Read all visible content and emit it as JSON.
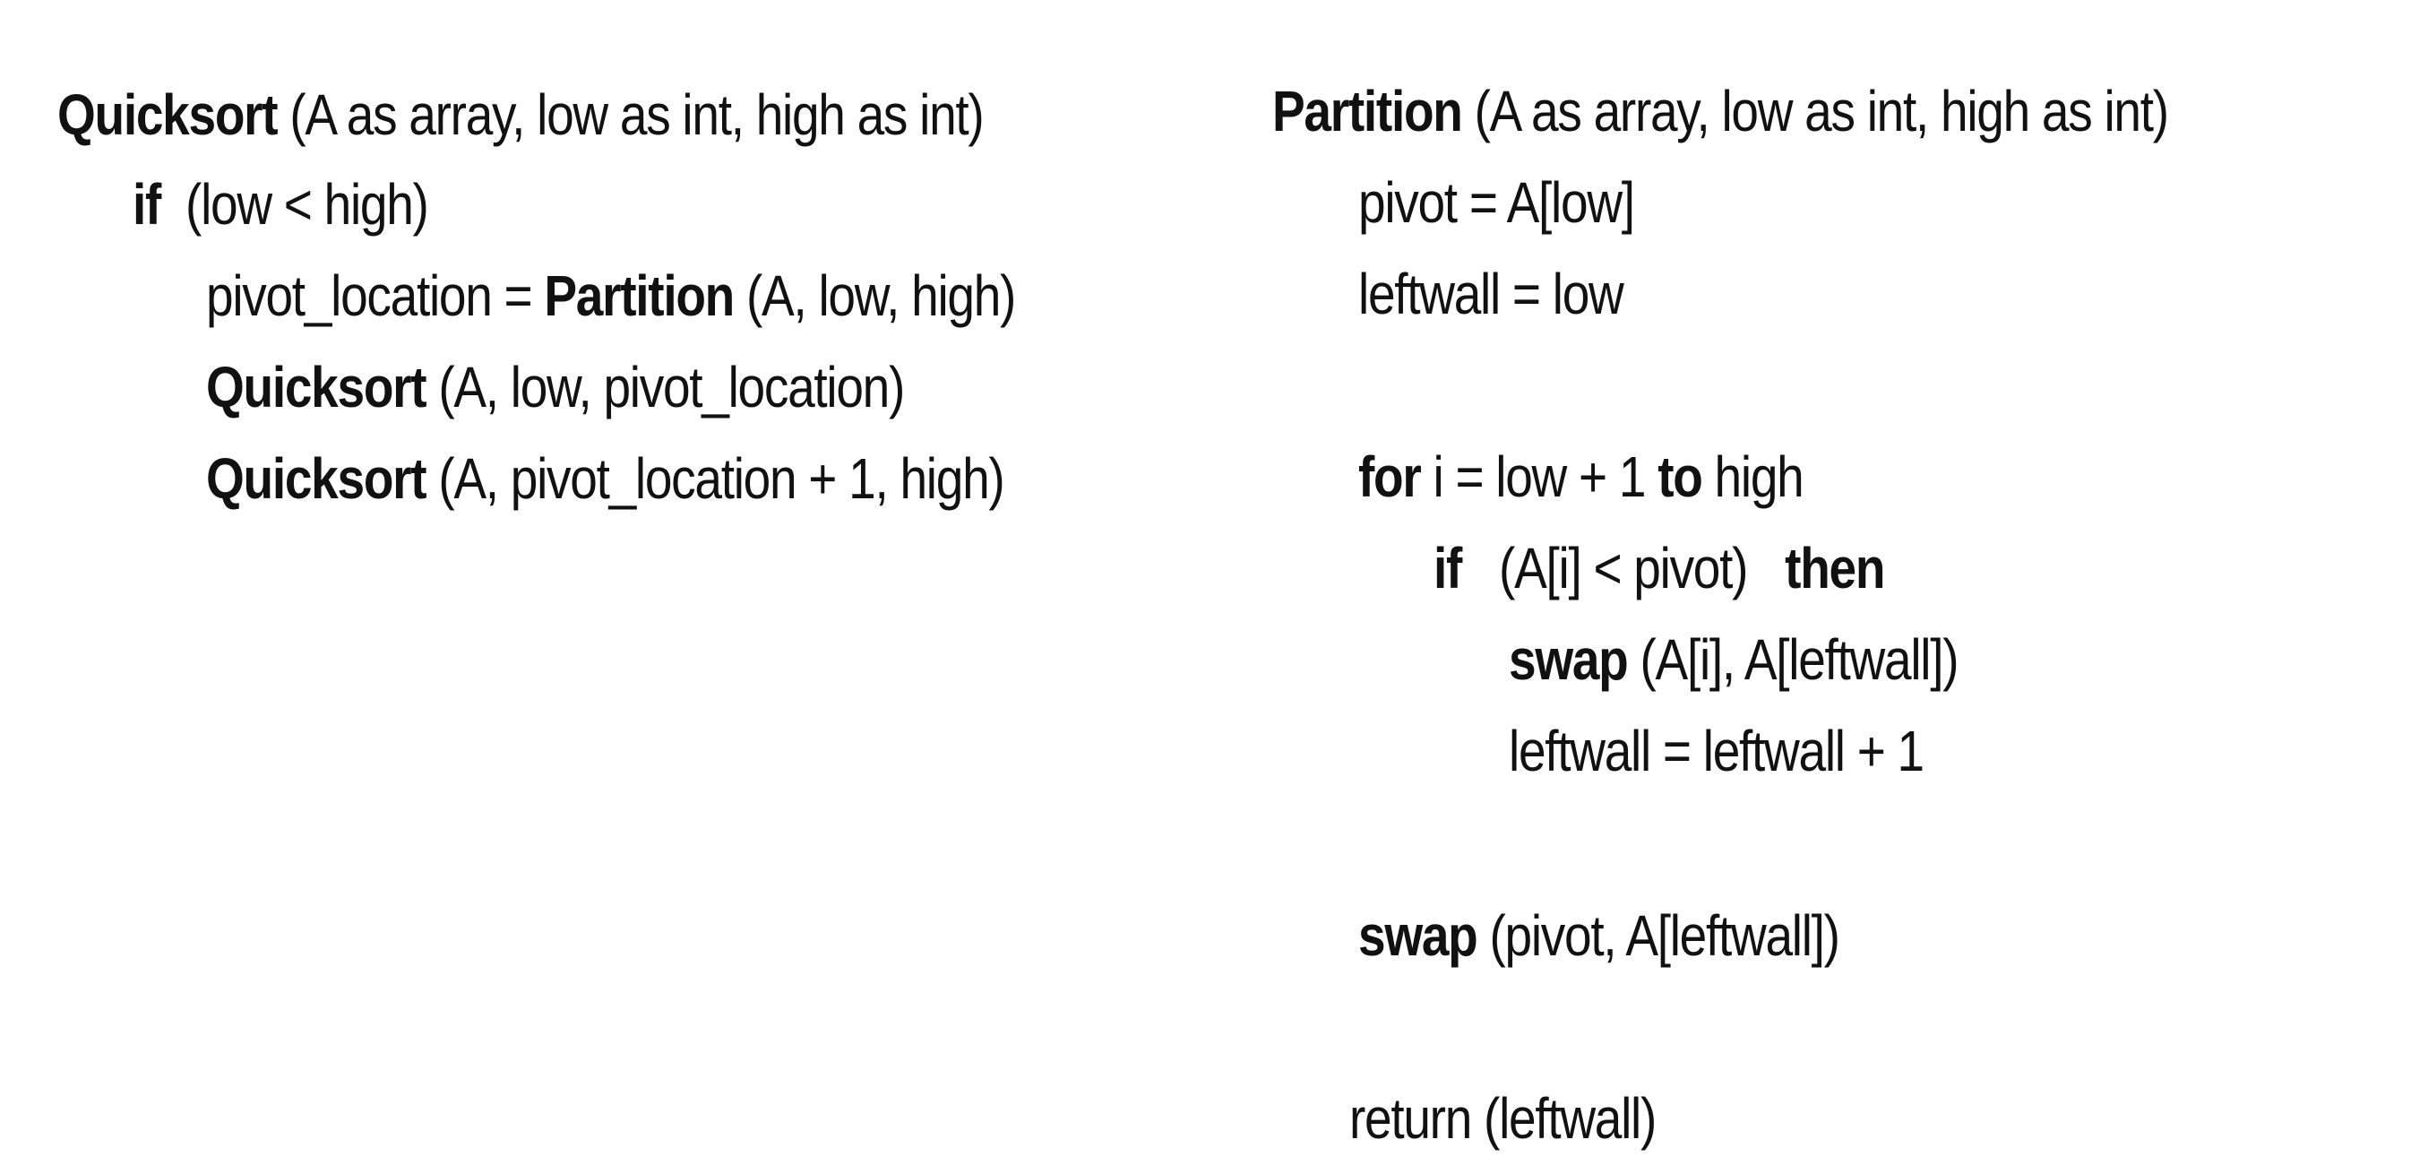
{
  "quicksort": {
    "lines": [
      {
        "keyword": "Quicksort",
        "text": " (A as array, low as int, high as int)"
      },
      {
        "keyword": "if",
        "text": "  (low < high)"
      },
      {
        "prefix": "pivot_location = ",
        "keyword": "Partition",
        "text": " (A, low, high)"
      },
      {
        "keyword": "Quicksort",
        "text": " (A, low, pivot_location)"
      },
      {
        "keyword": "Quicksort",
        "text": " (A, pivot_location + 1, high)"
      }
    ]
  },
  "partition": {
    "lines": [
      {
        "keyword": "Partition",
        "text": " (A as array, low as int, high as int)"
      },
      {
        "text": "pivot = A[low]"
      },
      {
        "text": "leftwall = low"
      },
      {
        "keyword": "for",
        "text": " i = low + 1 ",
        "keyword2": "to",
        "text2": " high"
      },
      {
        "keyword": "if",
        "text": "   (A[i] < pivot)   ",
        "keyword2": "then"
      },
      {
        "keyword": "swap",
        "text": " (A[i], A[leftwall])"
      },
      {
        "text": "leftwall = leftwall + 1"
      },
      {
        "keyword": "swap",
        "text": " (pivot, A[leftwall])"
      },
      {
        "text": "return (leftwall)"
      }
    ]
  }
}
